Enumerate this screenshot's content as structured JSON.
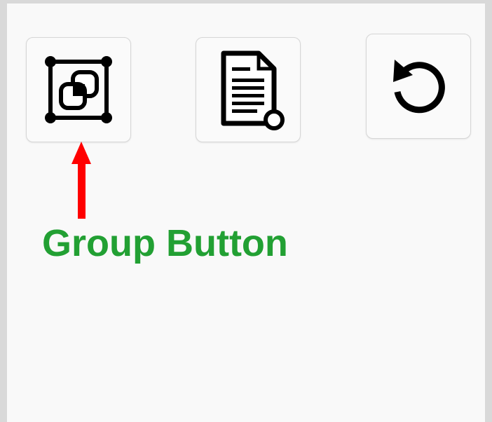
{
  "toolbar": {
    "buttons": [
      {
        "id": "group",
        "icon": "group-objects-icon"
      },
      {
        "id": "new-document",
        "icon": "document-add-icon"
      },
      {
        "id": "reset",
        "icon": "rotate-ccw-icon"
      }
    ]
  },
  "annotation": {
    "label": "Group Button",
    "label_color": "#22a033",
    "arrow_color": "#ff0000",
    "arrow_icon": "arrow-up-icon"
  }
}
